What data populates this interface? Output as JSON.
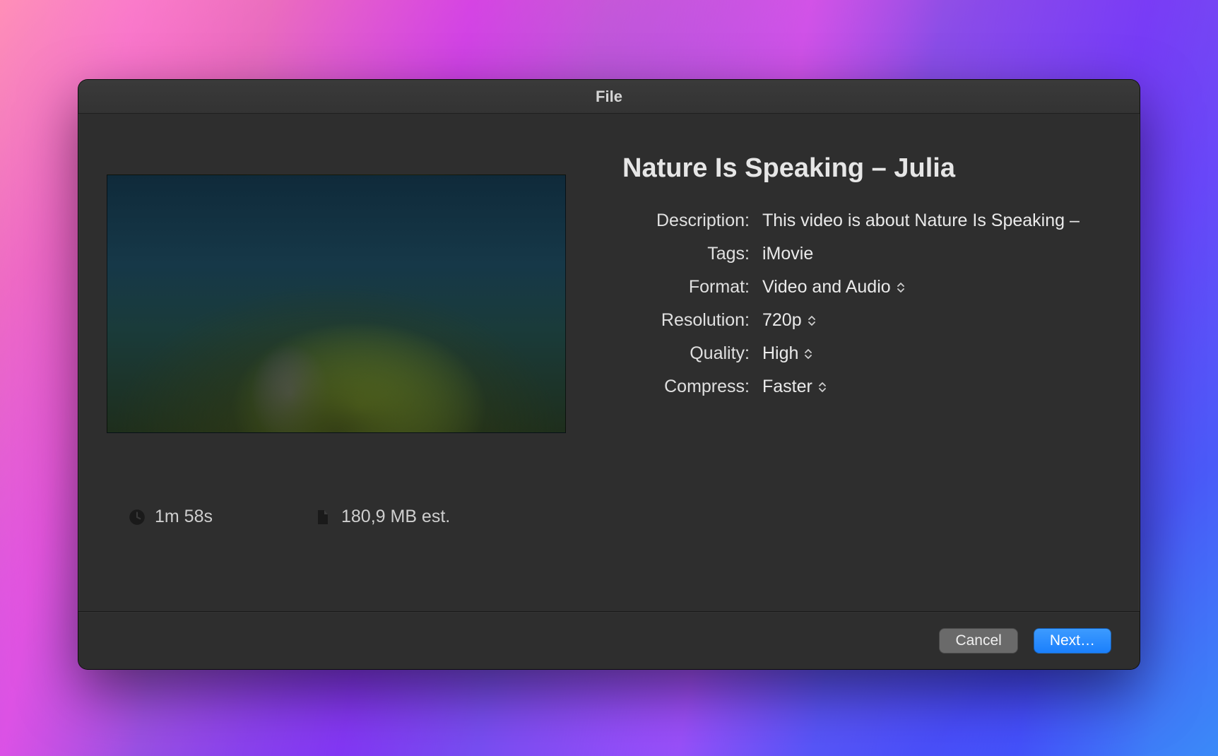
{
  "window": {
    "title": "File"
  },
  "project": {
    "title": "Nature Is Speaking – Julia"
  },
  "fields": {
    "labels": {
      "description": "Description:",
      "tags": "Tags:",
      "format": "Format:",
      "resolution": "Resolution:",
      "quality": "Quality:",
      "compress": "Compress:"
    },
    "values": {
      "description": "This video is about Nature Is Speaking –",
      "tags": "iMovie",
      "format": "Video and Audio",
      "resolution": "720p",
      "quality": "High",
      "compress": "Faster"
    }
  },
  "stats": {
    "duration": "1m 58s",
    "filesize": "180,9 MB est."
  },
  "buttons": {
    "cancel": "Cancel",
    "next": "Next…"
  }
}
